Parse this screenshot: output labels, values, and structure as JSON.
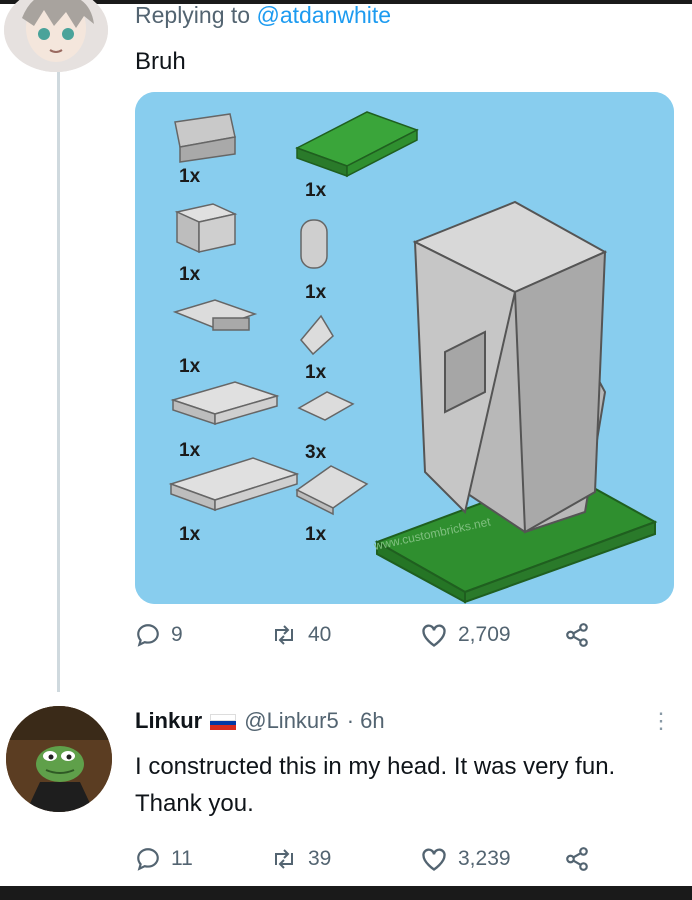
{
  "tweet1": {
    "reply_to_prefix": "Replying to ",
    "reply_to_handle": "@atdanwhite",
    "text": "Bruh",
    "media": {
      "watermark": "www.custombricks.net",
      "quantities_left": [
        "1x",
        "1x",
        "1x",
        "1x",
        "1x"
      ],
      "quantities_right": [
        "1x",
        "1x",
        "1x",
        "3x",
        "1x"
      ]
    },
    "actions": {
      "replies": "9",
      "retweets": "40",
      "likes": "2,709"
    }
  },
  "tweet2": {
    "name": "Linkur",
    "handle": "@Linkur5",
    "time": "· 6h",
    "text": "I constructed this in my head. It was very fun. Thank you.",
    "actions": {
      "replies": "11",
      "retweets": "39",
      "likes": "3,239"
    }
  },
  "colors": {
    "link": "#1d9bf0",
    "secondary": "#536471",
    "media_bg": "#88cdee",
    "brick_green": "#2f8f2f"
  }
}
